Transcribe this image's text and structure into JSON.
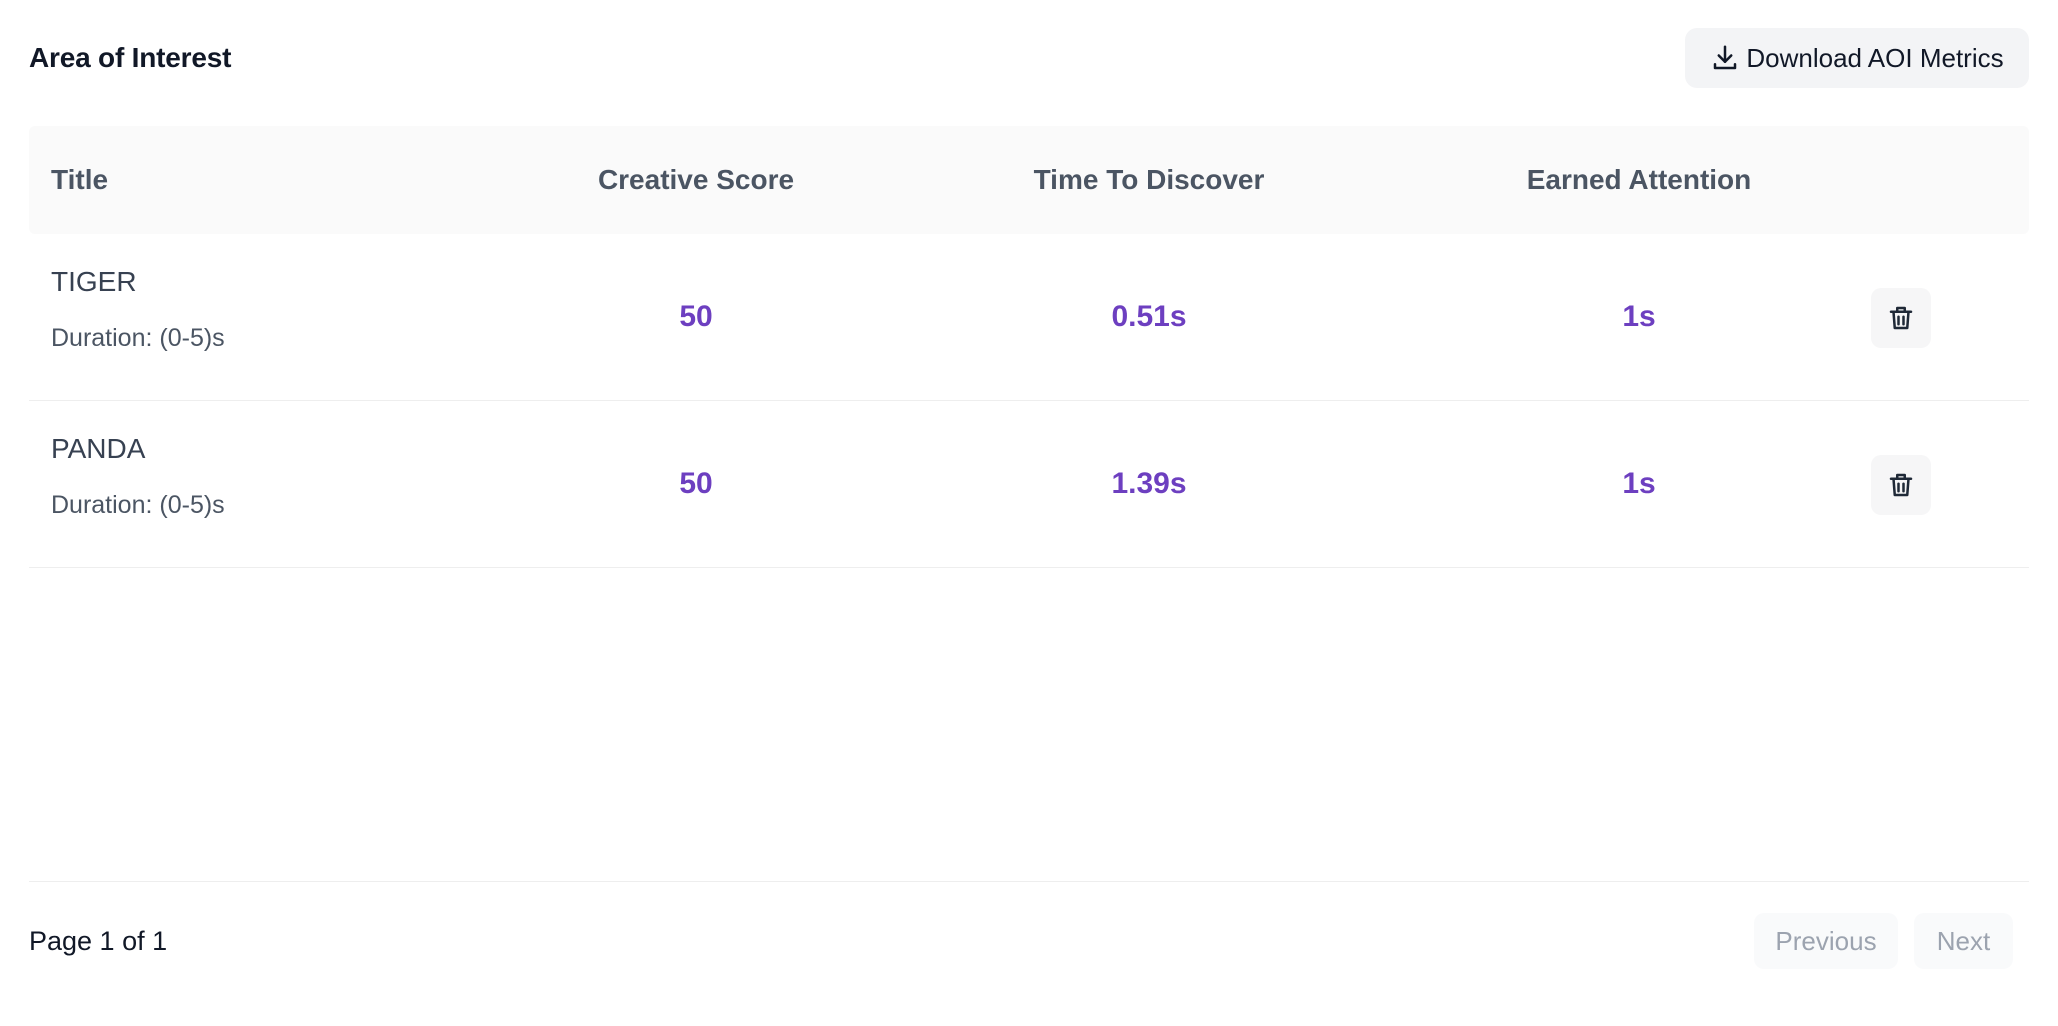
{
  "header": {
    "title": "Area of Interest",
    "download_label": "Download AOI Metrics",
    "download_icon": "download-icon"
  },
  "table": {
    "columns": [
      "Title",
      "Creative Score",
      "Time To Discover",
      "Earned Attention"
    ],
    "rows": [
      {
        "name": "TIGER",
        "duration": "Duration: (0-5)s",
        "creative_score": "50",
        "time_to_discover": "0.51s",
        "earned_attention": "1s",
        "action_icon": "trash-icon"
      },
      {
        "name": "PANDA",
        "duration": "Duration: (0-5)s",
        "creative_score": "50",
        "time_to_discover": "1.39s",
        "earned_attention": "1s",
        "action_icon": "trash-icon"
      }
    ]
  },
  "footer": {
    "page_info": "Page 1 of 1",
    "previous_label": "Previous",
    "next_label": "Next"
  },
  "colors": {
    "accent": "#6d3fc0",
    "header_bg": "#fafafa",
    "button_bg": "#f3f4f6"
  }
}
